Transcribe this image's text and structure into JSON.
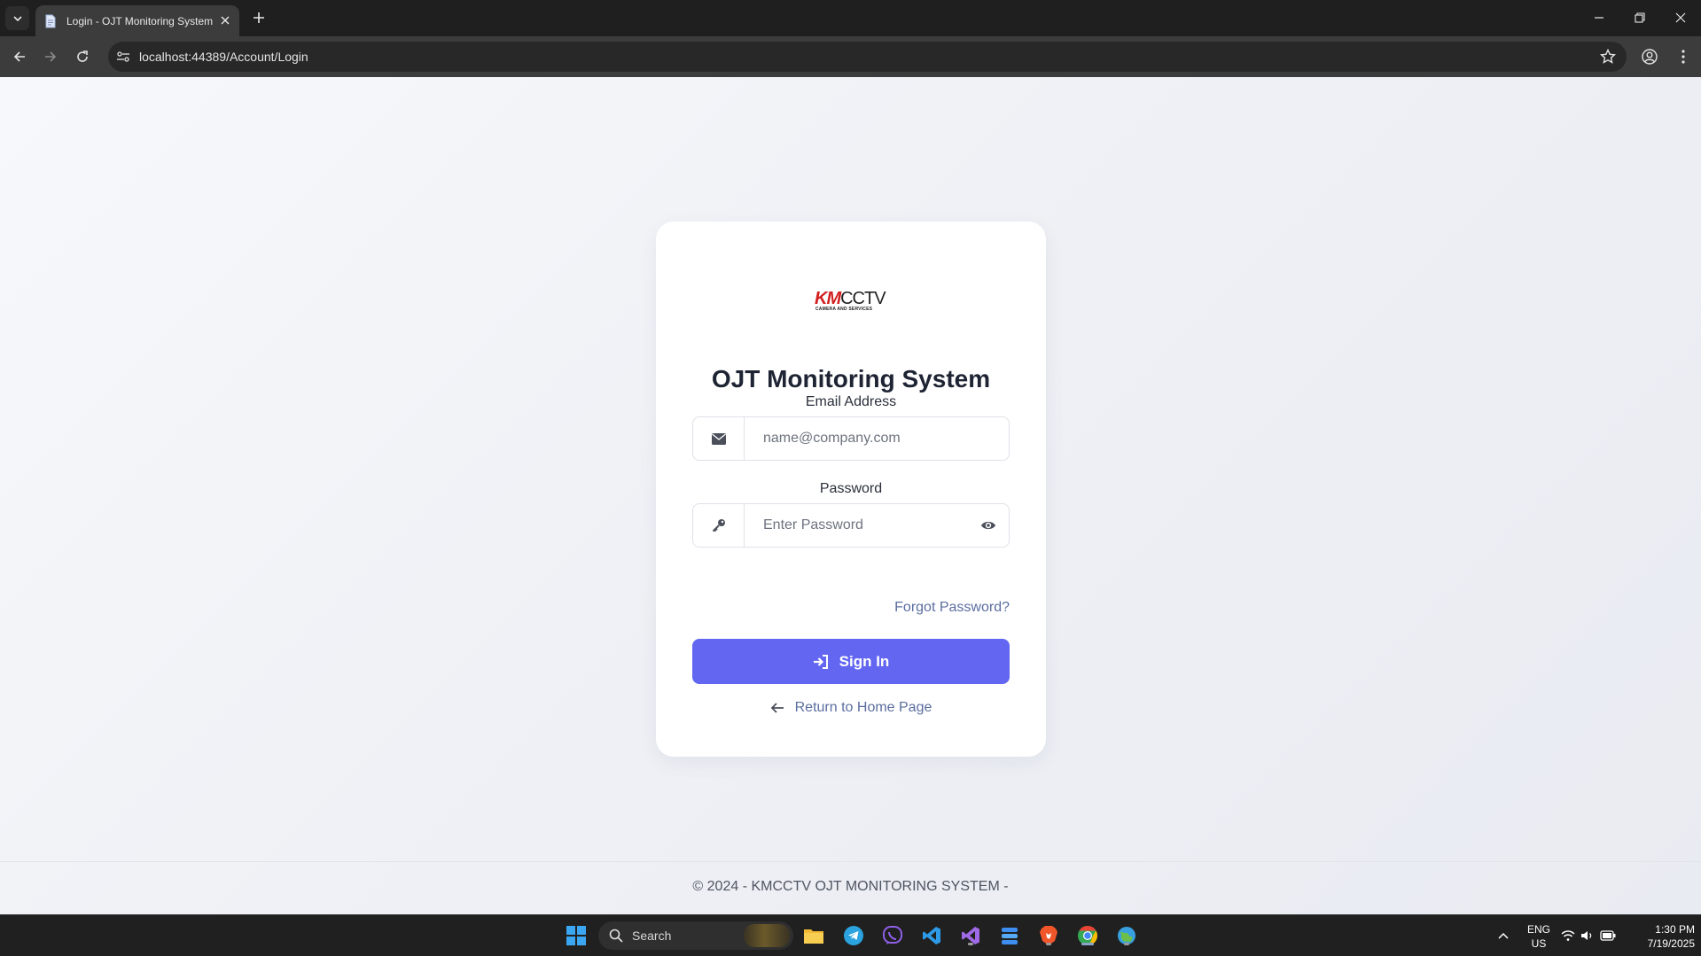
{
  "browser": {
    "tab_title": "Login - OJT Monitoring System",
    "url": "localhost:44389/Account/Login"
  },
  "login": {
    "logo_text_k": "KM",
    "logo_text_rest": "CCTV",
    "logo_tagline": "CAMERA AND SERVICES",
    "title": "OJT Monitoring System",
    "email_label": "Email Address",
    "email_placeholder": "name@company.com",
    "password_label": "Password",
    "password_placeholder": "Enter Password",
    "forgot_link": "Forgot Password?",
    "signin_label": "Sign In",
    "return_link": "Return to Home Page"
  },
  "footer": {
    "text": "© 2024 - KMCCTV OJT MONITORING SYSTEM -"
  },
  "taskbar": {
    "search_label": "Search",
    "lang_line1": "ENG",
    "lang_line2": "US",
    "time": "1:30 PM",
    "date": "7/19/2025"
  },
  "colors": {
    "primary": "#6366f1",
    "link": "#5b6ea0",
    "brand_red": "#d21f1f"
  }
}
